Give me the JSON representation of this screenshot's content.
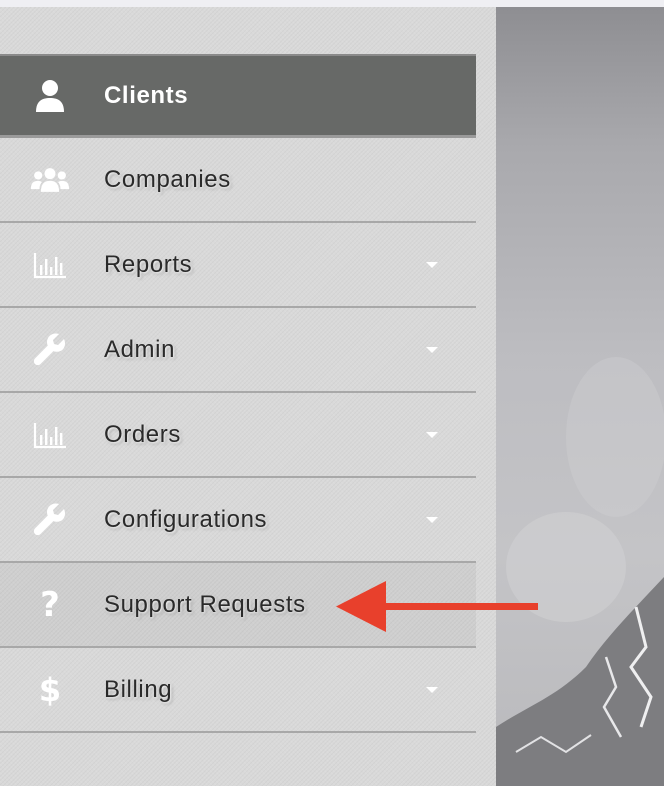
{
  "sidebar": {
    "items": [
      {
        "label": "Clients",
        "icon": "user-icon",
        "active": true,
        "dropdown": false
      },
      {
        "label": "Companies",
        "icon": "users-icon",
        "dropdown": false
      },
      {
        "label": "Reports",
        "icon": "bar-chart-icon",
        "dropdown": true
      },
      {
        "label": "Admin",
        "icon": "wrench-icon",
        "dropdown": true
      },
      {
        "label": "Orders",
        "icon": "bar-chart-icon",
        "dropdown": true
      },
      {
        "label": "Configurations",
        "icon": "wrench-icon",
        "dropdown": true
      },
      {
        "label": "Support Requests",
        "icon": "question-icon",
        "dropdown": false,
        "highlighted": true
      },
      {
        "label": "Billing",
        "icon": "dollar-icon",
        "dropdown": true
      }
    ]
  },
  "glyphs": {
    "question": "?",
    "dollar": "$"
  },
  "colors": {
    "active_bg": "#676967",
    "sidebar_bg": "#d9d9d9",
    "arrow": "#e8402c",
    "icon": "#ffffff"
  }
}
